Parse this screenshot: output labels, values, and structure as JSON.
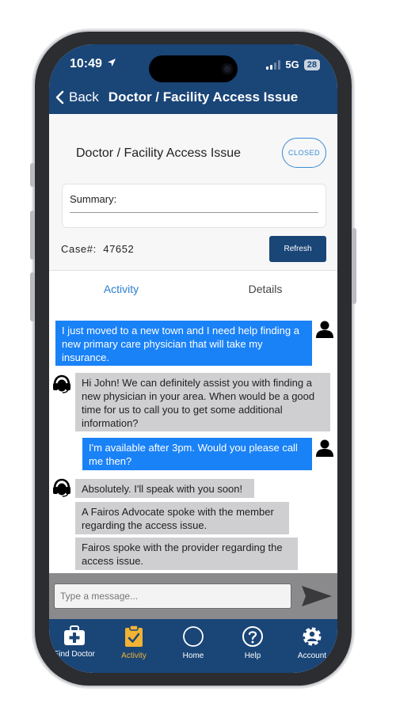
{
  "status_bar": {
    "time": "10:49",
    "network": "5G",
    "battery": "28"
  },
  "header": {
    "back_label": "Back",
    "title": "Doctor / Facility Access Issue"
  },
  "case": {
    "title": "Doctor / Facility Access Issue",
    "status_badge": "CLOSED",
    "summary_label": "Summary:",
    "case_number_label": "Case#:",
    "case_number": "47652",
    "refresh_label": "Refresh"
  },
  "tabs": [
    {
      "label": "Activity",
      "active": true
    },
    {
      "label": "Details",
      "active": false
    }
  ],
  "messages": [
    {
      "sender": "member",
      "lines": [
        "I just moved to a new town and I need help finding a",
        "new primary care physician that will take my",
        "insurance."
      ]
    },
    {
      "sender": "advocate",
      "lines": [
        "Hi John! We can definitely assist you with finding a",
        "new physician in your area. When would be a good",
        "time for us to call you to get some additional",
        "information?"
      ]
    },
    {
      "sender": "member",
      "lines": [
        "I'm available after 3pm. Would you please call",
        "me then?"
      ]
    },
    {
      "sender": "advocate",
      "lines": [
        "Absolutely. I'll speak with you soon!"
      ]
    },
    {
      "sender": "advocate",
      "lines": [
        "A Fairos Advocate spoke with the member",
        "regarding the access issue."
      ]
    },
    {
      "sender": "advocate",
      "lines": [
        "Fairos spoke with the provider regarding the",
        "access issue."
      ]
    }
  ],
  "composer": {
    "placeholder": "Type a message..."
  },
  "bottom_nav": [
    {
      "label": "Find Doctor",
      "icon": "medical-kit-icon",
      "active": false
    },
    {
      "label": "Activity",
      "icon": "clipboard-check-icon",
      "active": true
    },
    {
      "label": "Home",
      "icon": "circle-icon",
      "active": false
    },
    {
      "label": "Help",
      "icon": "question-icon",
      "active": false
    },
    {
      "label": "Account",
      "icon": "user-gear-icon",
      "active": false
    }
  ],
  "colors": {
    "header_bg": "#1a4577",
    "member_bubble": "#1a82f7",
    "advocate_bubble": "#cfcfd1",
    "active_tab_text": "#2d7fd0",
    "active_nav": "#f2b233"
  }
}
